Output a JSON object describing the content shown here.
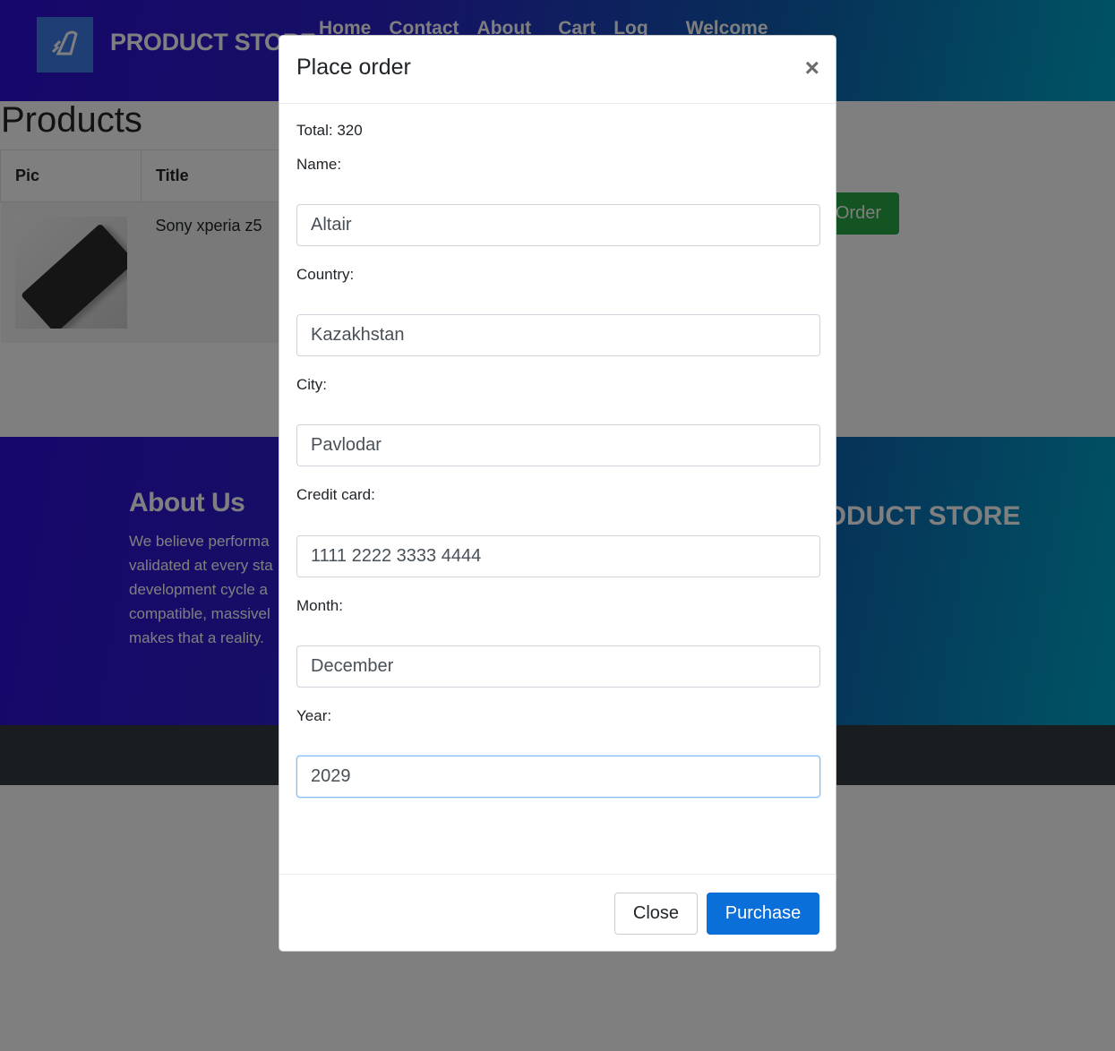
{
  "nav": {
    "brand": "PRODUCT STORE",
    "links": [
      "Home",
      "Contact",
      "About",
      "Cart",
      "Log",
      "Welcome"
    ]
  },
  "products": {
    "title": "Products",
    "columns": [
      "Pic",
      "Title"
    ],
    "rows": [
      {
        "title": "Sony xperia z5"
      }
    ],
    "order_button": "Order"
  },
  "footer": {
    "about_title": "About Us",
    "about_lines": [
      "We believe performa",
      "validated at every sta",
      "development cycle a",
      "compatible, massivel",
      "makes that a reality."
    ],
    "brand": "PRODUCT STORE"
  },
  "modal": {
    "title": "Place order",
    "close_symbol": "×",
    "total": "Total: 320",
    "fields": {
      "name": {
        "label": "Name:",
        "value": "Altair"
      },
      "country": {
        "label": "Country:",
        "value": "Kazakhstan"
      },
      "city": {
        "label": "City:",
        "value": "Pavlodar"
      },
      "card": {
        "label": "Credit card:",
        "value": "1111 2222 3333 4444"
      },
      "month": {
        "label": "Month:",
        "value": "December"
      },
      "year": {
        "label": "Year:",
        "value": "2029"
      }
    },
    "close_button": "Close",
    "purchase_button": "Purchase"
  },
  "colors": {
    "primary": "#0b6fd9",
    "success": "#28a745",
    "nav_gradient_start": "#2d0fd6",
    "nav_gradient_end": "#00a8c8"
  }
}
